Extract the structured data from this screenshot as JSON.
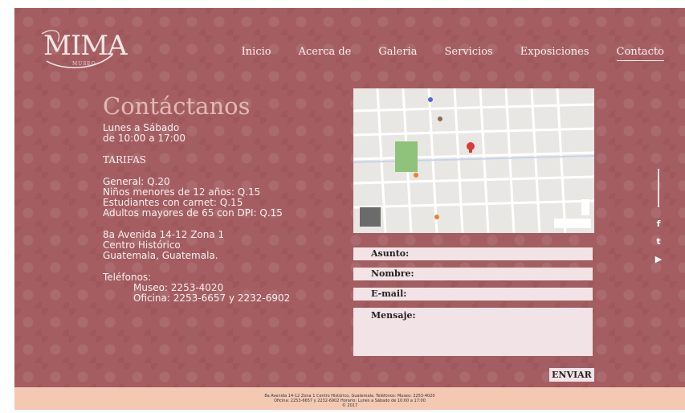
{
  "brand": {
    "logo_text": "MIMA",
    "logo_sub": "MUSEO"
  },
  "nav": {
    "items": [
      {
        "label": "Inicio"
      },
      {
        "label": "Acerca de"
      },
      {
        "label": "Galeria"
      },
      {
        "label": "Servicios"
      },
      {
        "label": "Exposiciones"
      },
      {
        "label": "Contacto",
        "active": true
      }
    ]
  },
  "contact": {
    "title": "Contáctanos",
    "hours": [
      "Lunes a Sábado",
      "de 10:00 a 17:00"
    ],
    "tarifas_heading": "TARIFAS",
    "tarifas": [
      "General: Q.20",
      "Niños menores de 12 años: Q.15",
      "Estudiantes con carnet: Q.15",
      "Adultos mayores de 65 con DPI: Q.15"
    ],
    "address": [
      "8a Avenida 14-12 Zona 1",
      "Centro Histórico",
      "Guatemala, Guatemala."
    ],
    "phones_label": "Teléfonos:",
    "phones": [
      "Museo: 2253-4020",
      "Oficina: 2253-6657 y 2232-6902"
    ]
  },
  "form": {
    "asunto_label": "Asunto:",
    "nombre_label": "Nombre:",
    "email_label": "E-mail:",
    "mensaje_label": "Mensaje:",
    "submit_label": "ENVIAR"
  },
  "social": {
    "icons": [
      "f",
      "t",
      "▶"
    ]
  },
  "footer": {
    "lines": [
      "8a Avenida 14-12 Zona 1 Centro Histórico, Guatemala. Teléfonos: Museo: 2253-4020",
      "Oficina: 2253-6657 y 2232-6902 Horario: Lunes a Sábado de 10:00 a 17:00",
      "© 2017"
    ]
  },
  "colors": {
    "background": "#a45e62",
    "footer": "#f3c9b4",
    "field": "#f2e3e6",
    "title": "#e3b9b3"
  }
}
